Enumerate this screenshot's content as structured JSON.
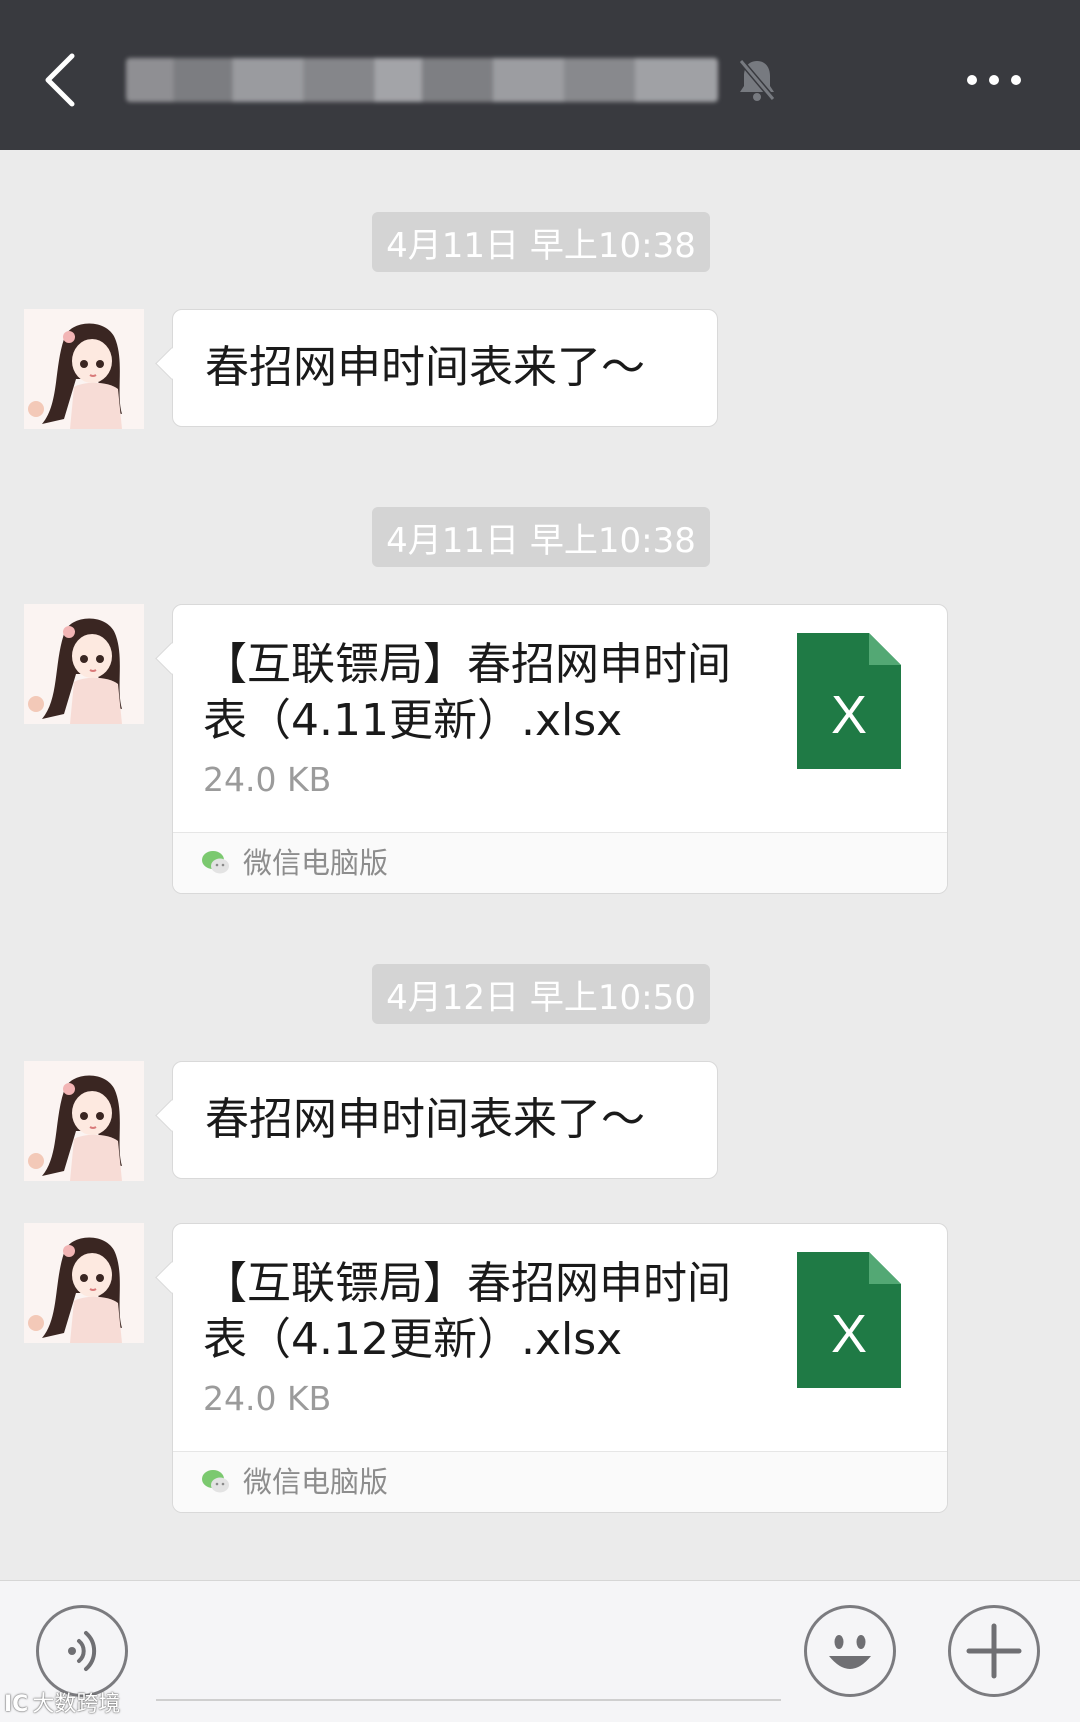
{
  "header": {
    "chat_title": "",
    "back_icon": "chevron-left-icon",
    "mute_icon": "bell-off-icon",
    "more_icon": "more-dots-icon"
  },
  "messages": [
    {
      "type": "time",
      "label": "4月11日 早上10:38"
    },
    {
      "type": "text",
      "text": "春招网申时间表来了～"
    },
    {
      "type": "time",
      "label": "4月11日 早上10:38"
    },
    {
      "type": "file",
      "name": "【互联镖局】春招网申时间表（4.11更新）.xlsx",
      "size": "24.0 KB",
      "source": "微信电脑版",
      "file_icon": "excel-icon",
      "file_icon_letter": "X"
    },
    {
      "type": "time",
      "label": "4月12日 早上10:50"
    },
    {
      "type": "text",
      "text": "春招网申时间表来了～"
    },
    {
      "type": "file",
      "name": "【互联镖局】春招网申时间表（4.12更新）.xlsx",
      "size": "24.0 KB",
      "source": "微信电脑版",
      "file_icon": "excel-icon",
      "file_icon_letter": "X"
    }
  ],
  "input_bar": {
    "voice_icon": "voice-icon",
    "emoji_icon": "emoji-icon",
    "add_icon": "plus-icon"
  },
  "watermark": {
    "logo": "IC",
    "text": "大数跨境"
  },
  "colors": {
    "header_bg": "#393a3f",
    "chat_bg": "#ebebeb",
    "time_label_bg": "#d4d4d4",
    "excel_green": "#1f7a45"
  }
}
